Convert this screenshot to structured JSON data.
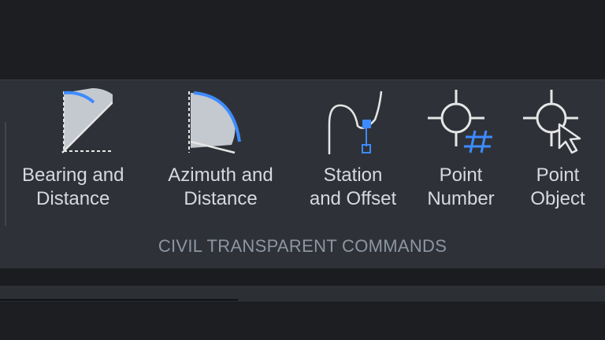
{
  "panel": {
    "title": "CIVIL TRANSPARENT COMMANDS"
  },
  "tools": [
    {
      "line1": "Bearing and",
      "line2": "Distance",
      "icon": "bearing-distance-icon"
    },
    {
      "line1": "Azimuth and",
      "line2": "Distance",
      "icon": "azimuth-distance-icon"
    },
    {
      "line1": "Station",
      "line2": "and Offset",
      "icon": "station-offset-icon"
    },
    {
      "line1": "Point",
      "line2": "Number",
      "icon": "point-number-icon"
    },
    {
      "line1": "Point",
      "line2": "Object",
      "icon": "point-object-icon"
    }
  ],
  "colors": {
    "ribbon_bg": "#2e3238",
    "label_text": "#d6d9de",
    "panel_title": "#8c96a3",
    "accent_blue": "#3d8bff",
    "icon_white": "#e6e6e6",
    "icon_fill": "#c4c8cf"
  }
}
